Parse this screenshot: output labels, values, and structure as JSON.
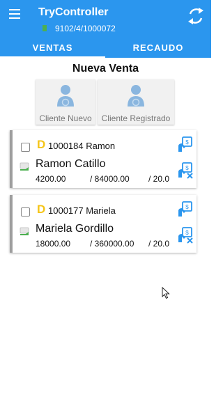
{
  "app": {
    "title": "TryController",
    "device_code": "9102/4/1000072",
    "status_color": "#4caf50",
    "header_color": "#2b96ee"
  },
  "tabs": [
    {
      "label": "VENTAS",
      "active": true
    },
    {
      "label": "RECAUDO",
      "active": false
    }
  ],
  "page": {
    "title": "Nueva Venta"
  },
  "client_buttons": {
    "new_label": "Cliente Nuevo",
    "registered_label": "Cliente Registrado"
  },
  "sales": [
    {
      "badge": "D",
      "code_name": "1000184 Ramon",
      "full_name": "Ramon Catillo",
      "amount": "4200.00",
      "total": "/ 84000.00",
      "rate": "/ 20.0"
    },
    {
      "badge": "D",
      "code_name": "1000177 Mariela",
      "full_name": "Mariela Gordillo",
      "amount": "18000.00",
      "total": "/ 360000.00",
      "rate": "/ 20.0"
    }
  ],
  "icons": {
    "menu": "hamburger-menu-icon",
    "sync": "sync-icon",
    "client": "person-icon",
    "pay": "cash-payment-icon",
    "cancel": "cash-cancel-icon",
    "status": "status-indicator-icon"
  }
}
